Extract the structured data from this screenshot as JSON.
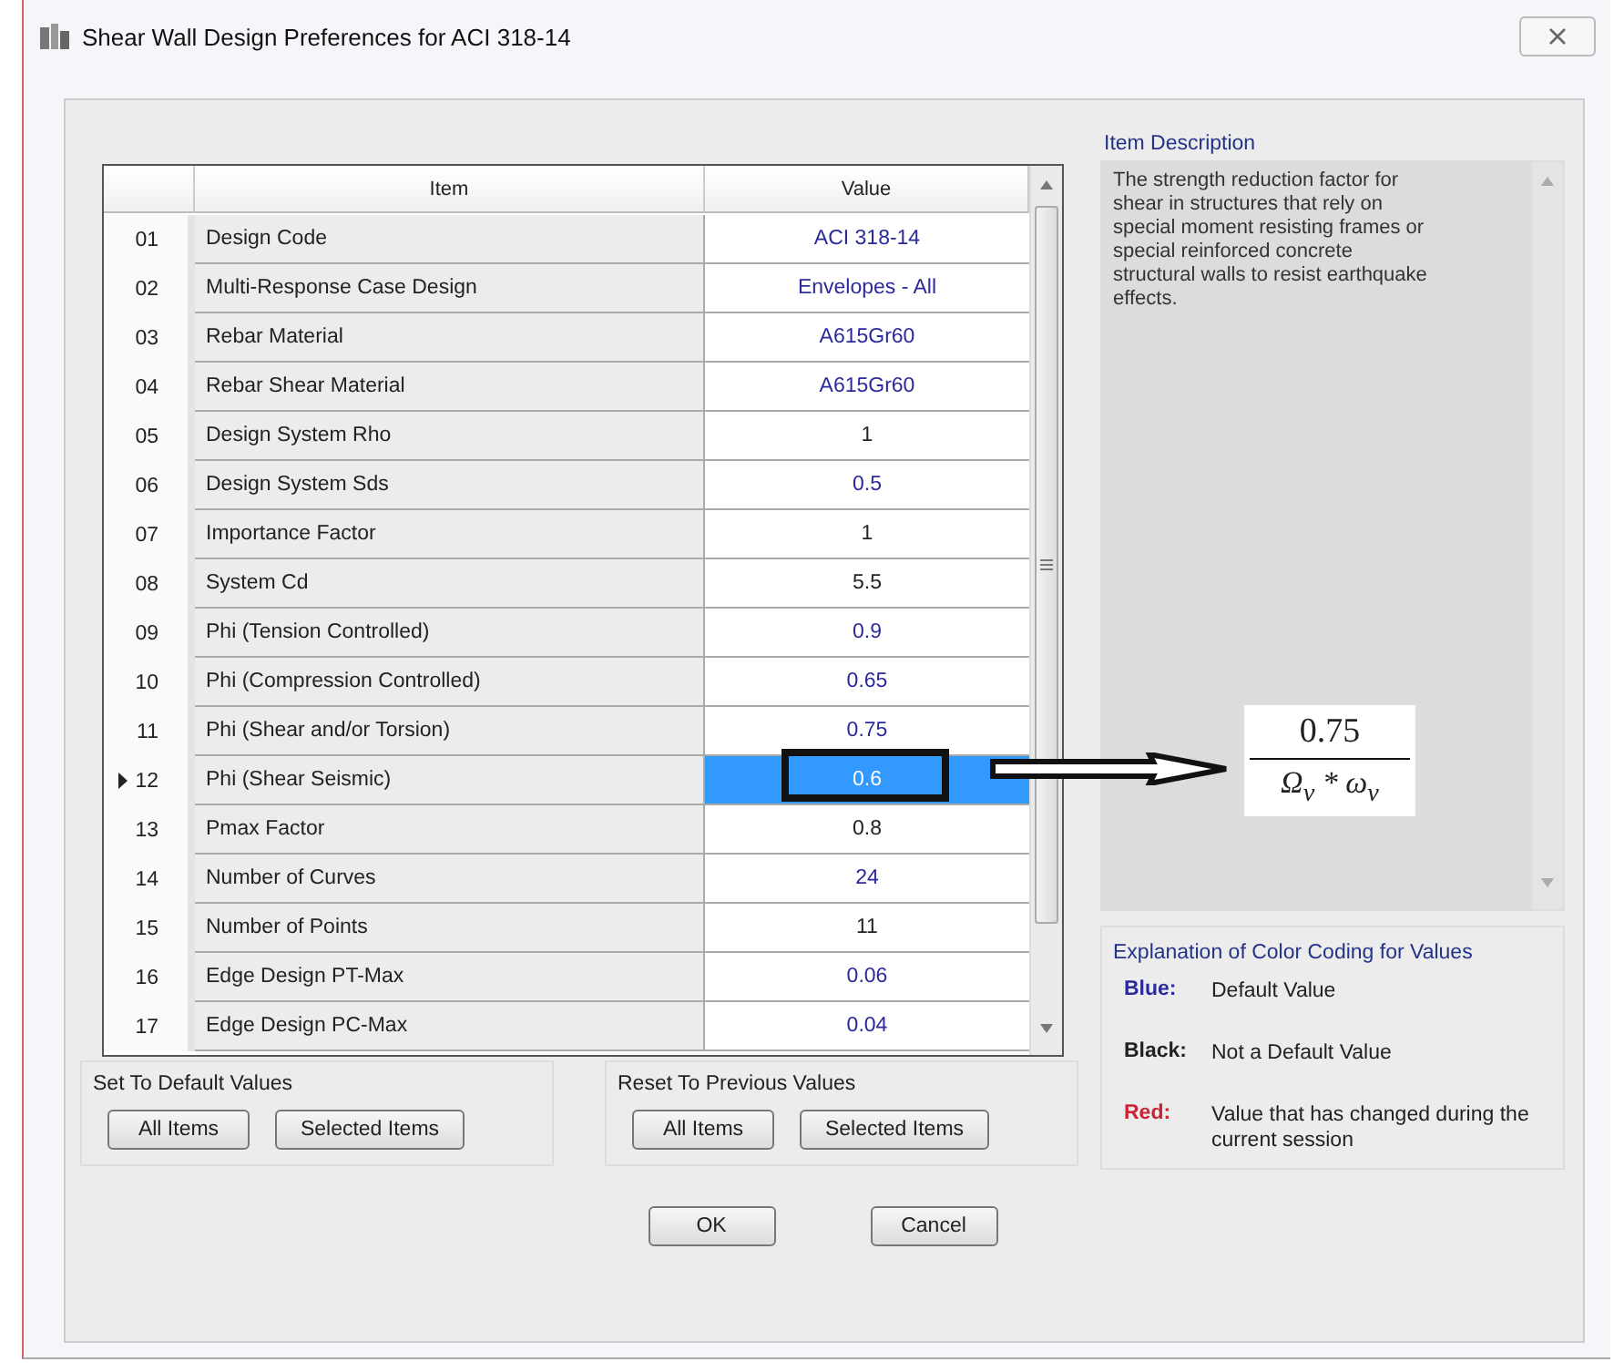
{
  "window": {
    "title": "Shear Wall Design Preferences for ACI 318-14"
  },
  "grid": {
    "columns": [
      "Item",
      "Value"
    ],
    "rows": [
      {
        "number": "01",
        "item": "Design Code",
        "value": "ACI 318-14",
        "is_default": true,
        "selected": false
      },
      {
        "number": "02",
        "item": "Multi-Response Case Design",
        "value": "Envelopes - All",
        "is_default": true,
        "selected": false
      },
      {
        "number": "03",
        "item": "Rebar Material",
        "value": "A615Gr60",
        "is_default": true,
        "selected": false
      },
      {
        "number": "04",
        "item": "Rebar Shear Material",
        "value": "A615Gr60",
        "is_default": true,
        "selected": false
      },
      {
        "number": "05",
        "item": "Design System Rho",
        "value": "1",
        "is_default": false,
        "selected": false
      },
      {
        "number": "06",
        "item": "Design System Sds",
        "value": "0.5",
        "is_default": true,
        "selected": false
      },
      {
        "number": "07",
        "item": "Importance Factor",
        "value": "1",
        "is_default": false,
        "selected": false
      },
      {
        "number": "08",
        "item": "System Cd",
        "value": "5.5",
        "is_default": false,
        "selected": false
      },
      {
        "number": "09",
        "item": "Phi (Tension Controlled)",
        "value": "0.9",
        "is_default": true,
        "selected": false
      },
      {
        "number": "10",
        "item": "Phi (Compression Controlled)",
        "value": "0.65",
        "is_default": true,
        "selected": false
      },
      {
        "number": "11",
        "item": "Phi (Shear and/or Torsion)",
        "value": "0.75",
        "is_default": true,
        "selected": false
      },
      {
        "number": "12",
        "item": "Phi (Shear Seismic)",
        "value": "0.6",
        "is_default": true,
        "selected": true
      },
      {
        "number": "13",
        "item": "Pmax Factor",
        "value": "0.8",
        "is_default": false,
        "selected": false
      },
      {
        "number": "14",
        "item": "Number of Curves",
        "value": "24",
        "is_default": true,
        "selected": false
      },
      {
        "number": "15",
        "item": "Number of Points",
        "value": "11",
        "is_default": false,
        "selected": false
      },
      {
        "number": "16",
        "item": "Edge Design PT-Max",
        "value": "0.06",
        "is_default": true,
        "selected": false
      },
      {
        "number": "17",
        "item": "Edge Design PC-Max",
        "value": "0.04",
        "is_default": true,
        "selected": false
      }
    ]
  },
  "set_default": {
    "title": "Set To Default Values",
    "buttons": [
      "All Items",
      "Selected Items"
    ]
  },
  "reset_previous": {
    "title": "Reset To Previous Values",
    "buttons": [
      "All Items",
      "Selected Items"
    ]
  },
  "item_description": {
    "title": "Item Description",
    "text": "The strength reduction factor for shear in structures that rely on special moment resisting frames or special reinforced concrete structural walls to resist earthquake effects."
  },
  "annotation": {
    "numerator": "0.75",
    "denominator": "Ω$_{v}$ * ω$_{v}$"
  },
  "color_coding": {
    "title": "Explanation of Color Coding for Values",
    "entries": [
      {
        "label": "Blue:",
        "meaning": "Default Value",
        "color": "#2a2a9a"
      },
      {
        "label": "Black:",
        "meaning": "Not a Default Value",
        "color": "#222222"
      },
      {
        "label": "Red:",
        "meaning": "Value that has changed during the current session",
        "color": "#cc2233"
      }
    ]
  },
  "buttons": [
    "OK",
    "Cancel"
  ]
}
